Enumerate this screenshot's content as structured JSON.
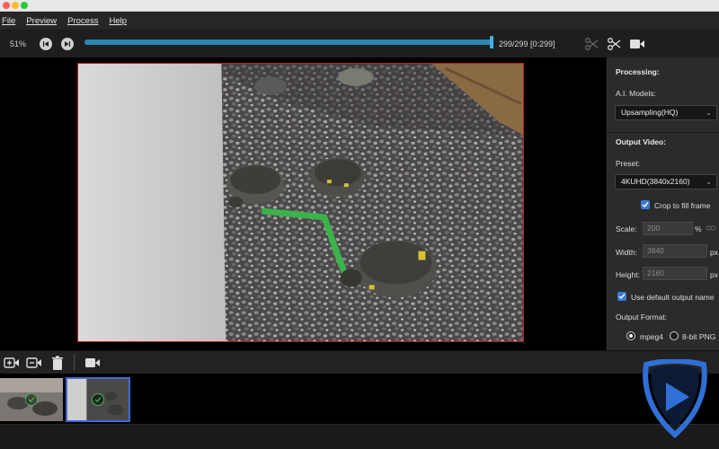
{
  "menu": {
    "file": "File",
    "preview": "Preview",
    "process": "Process",
    "help": "Help"
  },
  "transport": {
    "percent": "51%",
    "frames": "299/299  [0:299]",
    "progress": 1.0
  },
  "icons": {
    "prev": "skip-back-icon",
    "next": "skip-forward-icon",
    "cut": "scissors-icon",
    "split": "split-scissors-icon",
    "camera": "video-camera-icon",
    "logo": "play-shield-logo"
  },
  "panel": {
    "processing_title": "Processing:",
    "ai_models_label": "A.I. Models:",
    "ai_model_value": "Upsampling(HQ)",
    "output_title": "Output Video:",
    "preset_label": "Preset:",
    "preset_value": "4KUHD(3840x2160)",
    "crop_label": "Crop to fill frame",
    "scale_label": "Scale:",
    "scale_value": "200",
    "scale_unit": "%",
    "width_label": "Width:",
    "width_value": "3840",
    "width_unit": "px",
    "height_label": "Height:",
    "height_value": "2160",
    "height_unit": "px",
    "default_name_label": "Use default output name",
    "format_label": "Output Format:",
    "format_mpeg4": "mpeg4",
    "format_png": "8-bit PNG"
  },
  "colors": {
    "accent": "#3a78d6",
    "progress": "#2c88b2",
    "frame_border": "#b22222",
    "logo_blue": "#2f6fd6"
  }
}
